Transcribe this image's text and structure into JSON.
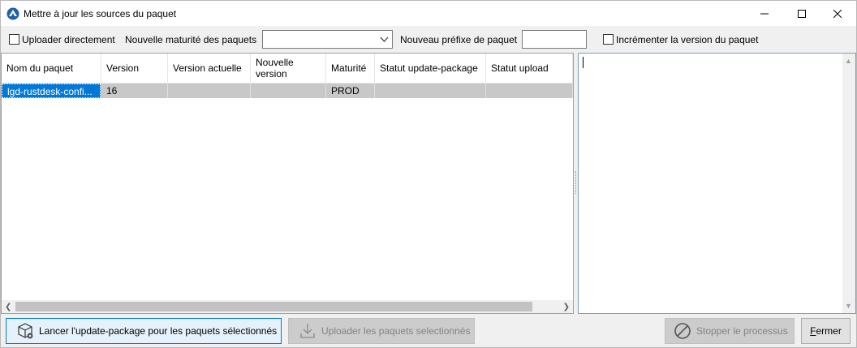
{
  "window": {
    "title": "Mettre à jour les sources du paquet"
  },
  "options": {
    "upload_direct_label": "Uploader directement",
    "upload_direct_checked": false,
    "new_maturity_label": "Nouvelle maturité des paquets",
    "new_maturity_value": "",
    "new_prefix_label": "Nouveau préfixe de paquet",
    "new_prefix_value": "",
    "increment_version_label": "Incrémenter la version du paquet",
    "increment_version_checked": false
  },
  "grid": {
    "columns": [
      "Nom du paquet",
      "Version",
      "Version actuelle",
      "Nouvelle version",
      "Maturité",
      "Statut update-package",
      "Statut upload"
    ],
    "rows": [
      {
        "name": "lgd-rustdesk-confi...",
        "version": "16",
        "current_version": "",
        "new_version": "",
        "maturity": "PROD",
        "update_status": "",
        "upload_status": ""
      }
    ]
  },
  "log": {
    "text": ""
  },
  "buttons": {
    "launch": "Lancer l'update-package pour les paquets sélectionnés",
    "upload": "Uploader les paquets selectionnés",
    "stop": "Stopper le processus",
    "close": "Fermer"
  },
  "colors": {
    "selection": "#0078d7",
    "row_background": "#c8c8c8",
    "disabled_text": "#838383"
  }
}
